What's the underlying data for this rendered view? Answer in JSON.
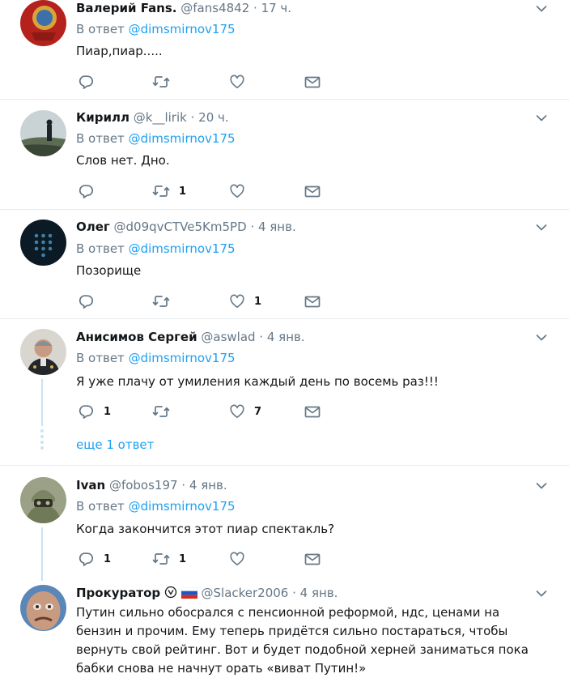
{
  "tweets": [
    {
      "name": "Валерий Fans.",
      "handle": "@fans4842",
      "time": "· 17 ч.",
      "reply_prefix": "В ответ",
      "reply_to": "@dimsmirnov175",
      "text": "Пиар,пиар.....",
      "replies": "",
      "retweets": "",
      "likes": ""
    },
    {
      "name": "Кирилл",
      "handle": "@k__lirik",
      "time": "· 20 ч.",
      "reply_prefix": "В ответ",
      "reply_to": "@dimsmirnov175",
      "text": "Слов нет. Дно.",
      "replies": "",
      "retweets": "1",
      "likes": ""
    },
    {
      "name": "Олег",
      "handle": "@d09qvCTVe5Km5PD",
      "time": "· 4 янв.",
      "reply_prefix": "В ответ",
      "reply_to": "@dimsmirnov175",
      "text": "Позорище",
      "replies": "",
      "retweets": "",
      "likes": "1"
    },
    {
      "name": "Анисимов Сергей",
      "handle": "@aswlad",
      "time": "· 4 янв.",
      "reply_prefix": "В ответ",
      "reply_to": "@dimsmirnov175",
      "text": "Я уже плачу от умиления каждый день по восемь раз!!!",
      "replies": "1",
      "retweets": "",
      "likes": "7"
    },
    {
      "name": "Ivan",
      "handle": "@fobos197",
      "time": "· 4 янв.",
      "reply_prefix": "В ответ",
      "reply_to": "@dimsmirnov175",
      "text": "Когда закончится этот пиар спектакль?",
      "replies": "1",
      "retweets": "1",
      "likes": ""
    },
    {
      "name": "Прокуратор",
      "handle": "@Slacker2006",
      "time": "· 4 янв.",
      "text": "Путин сильно обосрался с пенсионной реформой, ндс, ценами на бензин и прочим. Ему теперь придётся сильно постараться, чтобы вернуть свой рейтинг. Вот и будет подобной херней заниматься пока бабки снова не начнут орать «виват Путин!»"
    }
  ],
  "show_more": "еще 1 ответ",
  "icons": {
    "reply": "reply-icon",
    "retweet": "retweet-icon",
    "like": "heart-icon",
    "dm": "envelope-icon",
    "caret": "chevron-down-icon"
  },
  "colors": {
    "link": "#1da1f2",
    "muted": "#657786",
    "separator": "#e6ecf0"
  }
}
